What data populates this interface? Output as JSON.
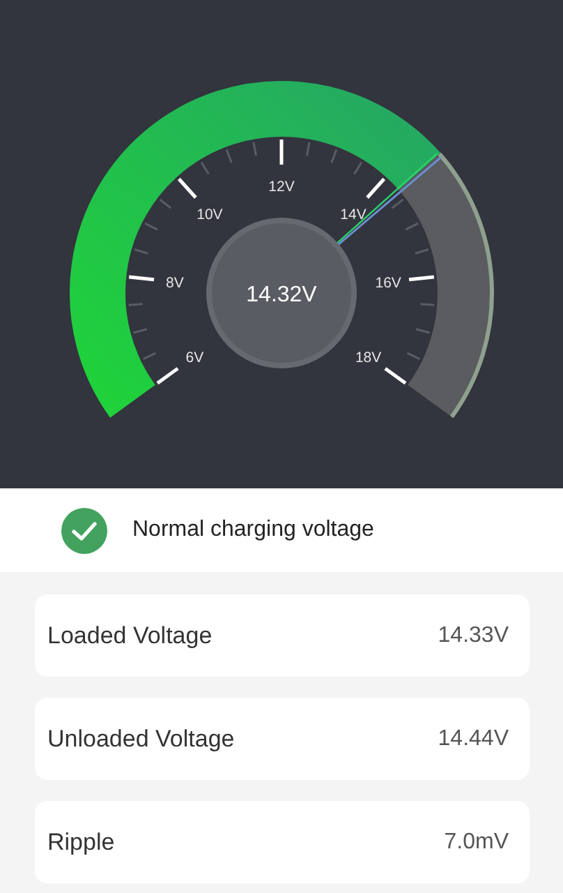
{
  "gauge": {
    "reading": "14.32V",
    "scale_labels": [
      "6V",
      "8V",
      "10V",
      "12V",
      "14V",
      "16V",
      "18V"
    ]
  },
  "status": {
    "ok": true,
    "text": "Normal charging voltage"
  },
  "readings": [
    {
      "label": "Loaded Voltage",
      "value": "14.33V"
    },
    {
      "label": "Unloaded Voltage",
      "value": "14.44V"
    },
    {
      "label": "Ripple",
      "value": "7.0mV"
    }
  ]
}
